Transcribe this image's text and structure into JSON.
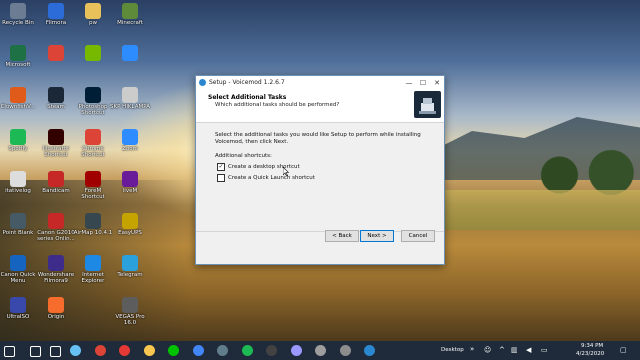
{
  "desktop_icons": [
    {
      "label": "Recycle Bin",
      "icon": "recycle-bin-icon",
      "color": "#6b7c93"
    },
    {
      "label": "Filmora",
      "icon": "filmora-icon",
      "color": "#2b6cd8"
    },
    {
      "label": "pw",
      "icon": "folder-icon",
      "color": "#e8c15a"
    },
    {
      "label": "Minecraft",
      "icon": "minecraft-icon",
      "color": "#5e8b3a"
    },
    {
      "label": "Microsoft",
      "icon": "excel-icon",
      "color": "#1e7145"
    },
    {
      "label": "",
      "icon": "chrome-icon",
      "color": "#db4437"
    },
    {
      "label": "",
      "icon": "nvidia-icon",
      "color": "#76b900"
    },
    {
      "label": "",
      "icon": "zoom-icon",
      "color": "#2d8cff"
    },
    {
      "label": "ClownfishV...",
      "icon": "clownfish-icon",
      "color": "#e05a1a"
    },
    {
      "label": "Steam",
      "icon": "steam-icon",
      "color": "#1b2838"
    },
    {
      "label": "Photoshop Shortcut",
      "icon": "photoshop-icon",
      "color": "#001e36"
    },
    {
      "label": "SKP HIKLAMPA",
      "icon": "file-icon",
      "color": "#cccccc"
    },
    {
      "label": "Spotify",
      "icon": "spotify-icon",
      "color": "#1db954"
    },
    {
      "label": "Illustrator Shortcut",
      "icon": "illustrator-icon",
      "color": "#330000"
    },
    {
      "label": "Chrome Shortcut",
      "icon": "chrome-icon",
      "color": "#db4437"
    },
    {
      "label": "Zoom",
      "icon": "zoom-icon",
      "color": "#2d8cff"
    },
    {
      "label": "itativelog",
      "icon": "file-icon",
      "color": "#dddddd"
    },
    {
      "label": "Bandicam",
      "icon": "bandicam-icon",
      "color": "#c62828"
    },
    {
      "label": "ForeM Shortcut",
      "icon": "app-icon",
      "color": "#a00000"
    },
    {
      "label": "liveM",
      "icon": "app-icon",
      "color": "#6a1b9a"
    },
    {
      "label": "Point Blank",
      "icon": "pointblank-icon",
      "color": "#455a64"
    },
    {
      "label": "Canon G2010 series Onlin...",
      "icon": "canon-icon",
      "color": "#c62828"
    },
    {
      "label": "AirMap 10.4.1",
      "icon": "airmap-icon",
      "color": "#37474f"
    },
    {
      "label": "EasyUPS",
      "icon": "easyups-icon",
      "color": "#c5a300"
    },
    {
      "label": "Canon Quick Menu",
      "icon": "canon-icon",
      "color": "#1565c0"
    },
    {
      "label": "Wondershare Filmora9",
      "icon": "filmora-icon",
      "color": "#3e2c8a"
    },
    {
      "label": "Internet Explorer",
      "icon": "ie-icon",
      "color": "#1e88e5"
    },
    {
      "label": "Telegram",
      "icon": "telegram-icon",
      "color": "#2aa1da"
    },
    {
      "label": "UltraISO",
      "icon": "ultraiso-icon",
      "color": "#3949ab"
    },
    {
      "label": "Origin",
      "icon": "origin-icon",
      "color": "#f56c2d"
    },
    {
      "label": "",
      "icon": "blank-icon",
      "color": "transparent"
    },
    {
      "label": "VEGAS Pro 16.0",
      "icon": "vegas-icon",
      "color": "#5d5d5d"
    }
  ],
  "dialog": {
    "title": "Setup - Voicemod 1.2.6.7",
    "controls": {
      "minimize": "—",
      "maximize": "☐",
      "close": "✕"
    },
    "header_title": "Select Additional Tasks",
    "header_subtitle": "Which additional tasks should be performed?",
    "description": "Select the additional tasks you would like Setup to perform while installing Voicemod, then click Next.",
    "shortcuts_label": "Additional shortcuts:",
    "options": [
      {
        "label": "Create a desktop shortcut",
        "checked": true
      },
      {
        "label": "Create a Quick Launch shortcut",
        "checked": false
      }
    ],
    "buttons": {
      "back": "< Back",
      "next": "Next >",
      "cancel": "Cancel"
    }
  },
  "taskbar": {
    "desktop_label": "Desktop",
    "time": "9:34 PM",
    "date": "4/23/2020",
    "apps": [
      {
        "icon": "start-icon",
        "color": "#ffffff"
      },
      {
        "icon": "search-icon",
        "color": "#ffffff"
      },
      {
        "icon": "task-view-icon",
        "color": "#ffffff"
      },
      {
        "icon": "steam-icon",
        "color": "#66c0f4"
      },
      {
        "icon": "chrome-icon",
        "color": "#db4437"
      },
      {
        "icon": "app-icon",
        "color": "#e53935"
      },
      {
        "icon": "file-explorer-icon",
        "color": "#f9c74f"
      },
      {
        "icon": "line-icon",
        "color": "#00c300"
      },
      {
        "icon": "chrome-icon",
        "color": "#4285f4"
      },
      {
        "icon": "app-icon",
        "color": "#607d8b"
      },
      {
        "icon": "spotify-icon",
        "color": "#1db954"
      },
      {
        "icon": "obs-icon",
        "color": "#424242"
      },
      {
        "icon": "premiere-icon",
        "color": "#9999ff"
      },
      {
        "icon": "app-icon",
        "color": "#9e9e9e"
      },
      {
        "icon": "vegas-icon",
        "color": "#8d8d8d"
      },
      {
        "icon": "voicemod-icon",
        "color": "#2a87d0"
      }
    ]
  }
}
